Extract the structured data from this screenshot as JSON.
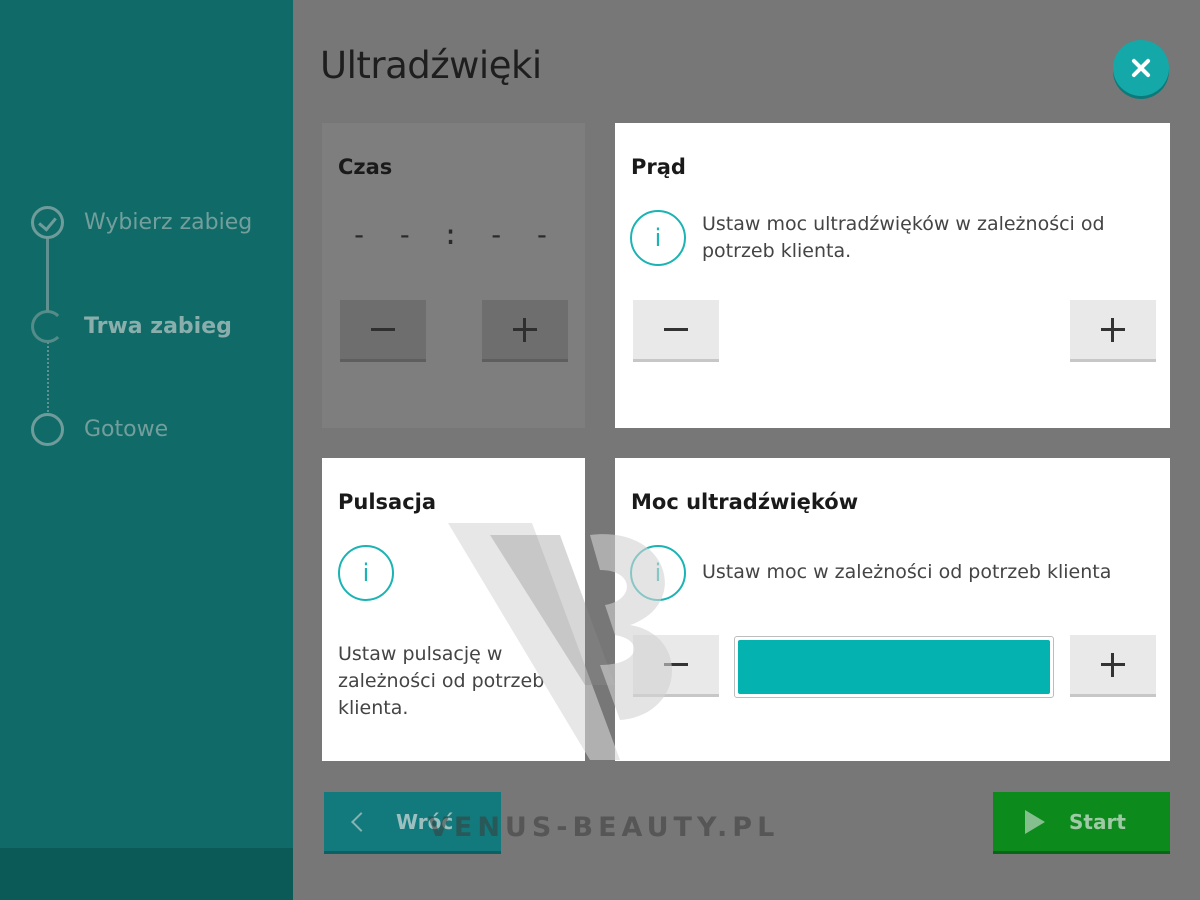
{
  "page": {
    "title": "Ultradźwięki"
  },
  "sidebar": {
    "steps": [
      {
        "label": "Wybierz zabieg",
        "state": "done"
      },
      {
        "label": "Trwa zabieg",
        "state": "active"
      },
      {
        "label": "Gotowe",
        "state": "pending"
      }
    ]
  },
  "cards": {
    "czas": {
      "title": "Czas",
      "display": "- - : - -",
      "minus_symbol": "−",
      "plus_symbol": "+"
    },
    "prad": {
      "title": "Prąd",
      "info_glyph": "i",
      "description": "Ustaw moc ultradźwięków w zależności od potrzeb klienta."
    },
    "pulsacja": {
      "title": "Pulsacja",
      "info_glyph": "i",
      "description": "Ustaw pulsację w zależności od potrzeb klienta."
    },
    "moc": {
      "title": "Moc ultradźwięków",
      "info_glyph": "i",
      "description": "Ustaw moc w zależności od potrzeb klienta",
      "level_fraction": 1.0
    }
  },
  "footer": {
    "back_label": "Wróć",
    "start_label": "Start"
  },
  "watermark": {
    "text": "VENUS-BEAUTY.PL"
  },
  "colors": {
    "sidebar": "#106b68",
    "accent": "#15a8a8",
    "start": "#0c8a1c",
    "bar_fill": "#04b2b0"
  }
}
